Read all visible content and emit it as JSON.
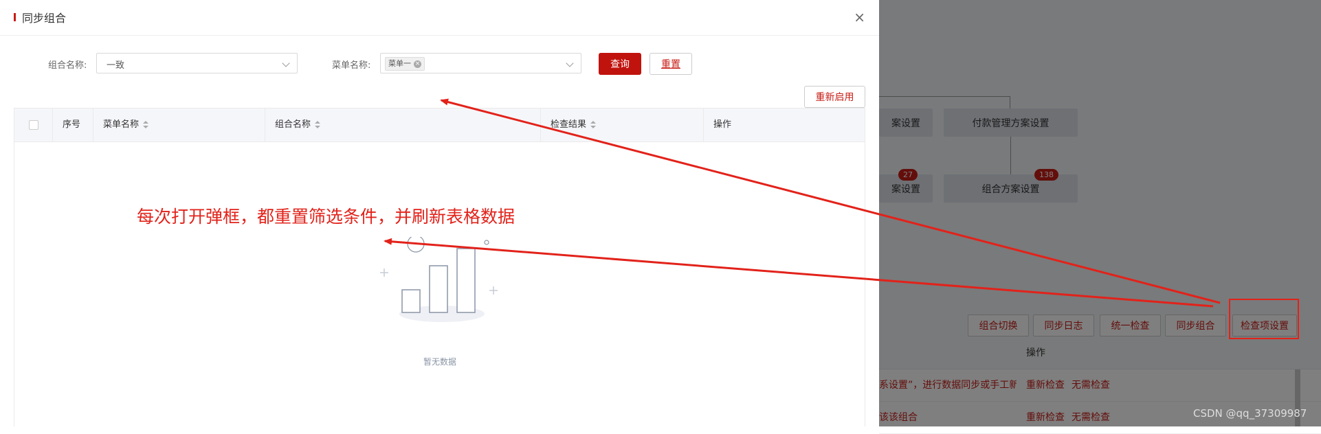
{
  "modal": {
    "title": "同步组合",
    "close_symbol": "×",
    "filters": {
      "group_label": "组合名称:",
      "group_value": "一致",
      "menu_label": "菜单名称:",
      "menu_tag": "菜单一",
      "query_button": "查询",
      "reset_button": "重置"
    },
    "restart_button": "重新启用",
    "table": {
      "columns": [
        "序号",
        "菜单名称",
        "组合名称",
        "检查结果",
        "操作"
      ],
      "empty_text": "暂无数据"
    }
  },
  "annotation": {
    "text": "每次打开弹框，都重置筛选条件，并刷新表格数据",
    "color": "#e2221a"
  },
  "background": {
    "nodes": [
      "案设置",
      "付款管理方案设置",
      "案设置",
      "组合方案设置"
    ],
    "badges": [
      "27",
      "138"
    ],
    "toolbar": [
      "组合切换",
      "同步日志",
      "统一检查",
      "同步组合",
      "检查项设置"
    ],
    "table_header": "操作",
    "rows": [
      {
        "text": "系设置”，进行数据同步或手工新",
        "actions": [
          "重新检查",
          "无需检查"
        ]
      },
      {
        "text": "该该组合",
        "actions": [
          "重新检查",
          "无需检查"
        ]
      }
    ]
  },
  "watermark": "CSDN @qq_37309987",
  "colors": {
    "brand": "#c0130d",
    "annotation": "#e2221a"
  }
}
